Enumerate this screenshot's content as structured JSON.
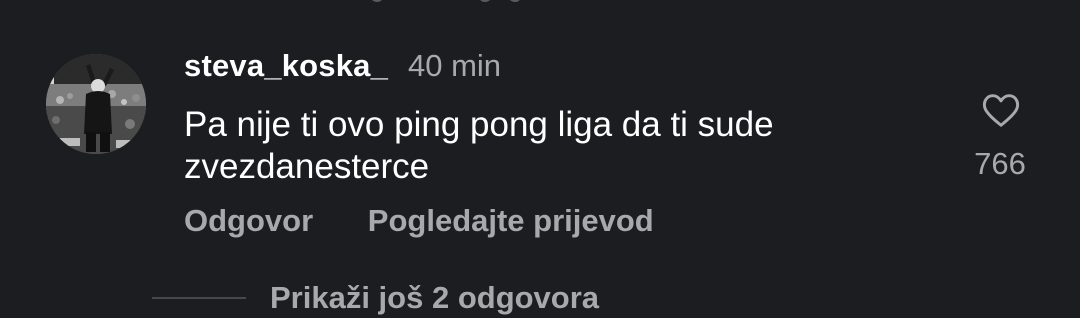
{
  "previous_comment": {
    "note_icon": "cut-off-row-fragment"
  },
  "comment": {
    "avatar_icon": "user-avatar-photo",
    "username": "steva_koska_",
    "timestamp": "40 min",
    "text": "Pa nije ti ovo ping pong liga da ti sude zvezdanesterce",
    "like_icon": "heart-outline-icon",
    "like_count": "766",
    "actions": {
      "reply_label": "Odgovor",
      "translate_label": "Pogledajte prijevod"
    }
  },
  "replies": {
    "toggle_label": "Prikaži još 2 odgovora"
  },
  "colors": {
    "background": "#1c1d20",
    "primary_text": "#ffffff",
    "secondary_text": "#a8a9ad",
    "divider": "#47484c"
  }
}
